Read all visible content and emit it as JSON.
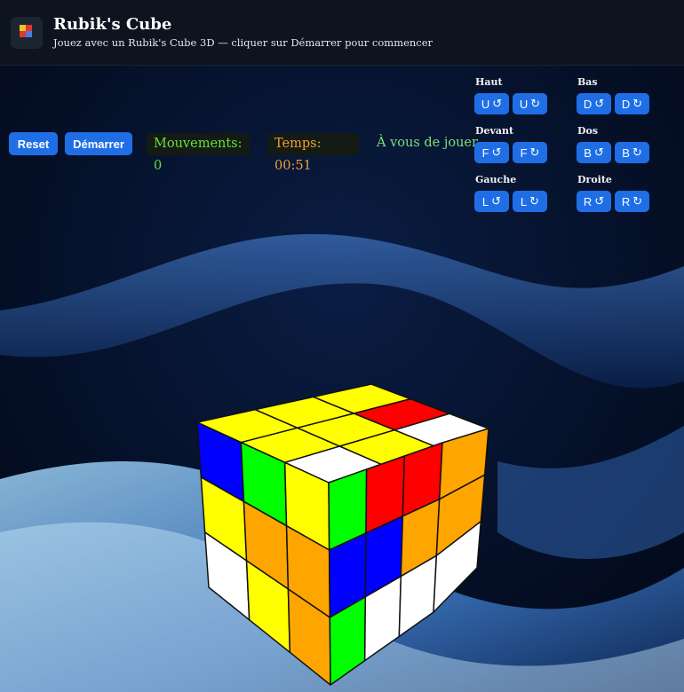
{
  "header": {
    "title": "Rubik's Cube",
    "subtitle": "Jouez avec un Rubik's Cube 3D — cliquer sur Démarrer pour commencer",
    "logo_icon": "rubiks-cube-logo-icon"
  },
  "controls": {
    "reset_label": "Reset",
    "start_label": "Démarrer",
    "moves_text": "Mouvements: 0",
    "time_text": "Temps: 00:51",
    "status_text": "À vous de jouer"
  },
  "move_groups": [
    {
      "label": "Haut",
      "buttons": [
        {
          "face": "U",
          "arrow": "↺"
        },
        {
          "face": "U",
          "arrow": "↻"
        }
      ]
    },
    {
      "label": "Bas",
      "buttons": [
        {
          "face": "D",
          "arrow": "↺"
        },
        {
          "face": "D",
          "arrow": "↻"
        }
      ]
    },
    {
      "label": "Devant",
      "buttons": [
        {
          "face": "F",
          "arrow": "↺"
        },
        {
          "face": "F",
          "arrow": "↻"
        }
      ]
    },
    {
      "label": "Dos",
      "buttons": [
        {
          "face": "B",
          "arrow": "↺"
        },
        {
          "face": "B",
          "arrow": "↻"
        }
      ]
    },
    {
      "label": "Gauche",
      "buttons": [
        {
          "face": "L",
          "arrow": "↺"
        },
        {
          "face": "L",
          "arrow": "↻"
        }
      ]
    },
    {
      "label": "Droite",
      "buttons": [
        {
          "face": "R",
          "arrow": "↺"
        },
        {
          "face": "R",
          "arrow": "↻"
        }
      ]
    }
  ],
  "colors": {
    "accent": "#1f6ee6",
    "moves_color": "#66e33a",
    "time_color": "#f0a030",
    "status_color": "#7ee07a",
    "stickers": {
      "Y": "#ffff00",
      "W": "#ffffff",
      "B": "#0000ff",
      "G": "#00ff00",
      "R": "#ff0000",
      "O": "#ffa500"
    }
  },
  "cube": {
    "top": [
      [
        "Y",
        "Y",
        "Y"
      ],
      [
        "Y",
        "Y",
        "R"
      ],
      [
        "W",
        "Y",
        "W"
      ]
    ],
    "left": [
      [
        "B",
        "G",
        "Y"
      ],
      [
        "Y",
        "O",
        "O"
      ],
      [
        "W",
        "Y",
        "O"
      ]
    ],
    "front": [
      [
        "G",
        "R",
        "R"
      ],
      [
        "B",
        "B",
        "O"
      ],
      [
        "G",
        "W",
        "W"
      ]
    ],
    "right": [
      [
        "O"
      ],
      [
        "O"
      ],
      [
        "W"
      ]
    ]
  }
}
